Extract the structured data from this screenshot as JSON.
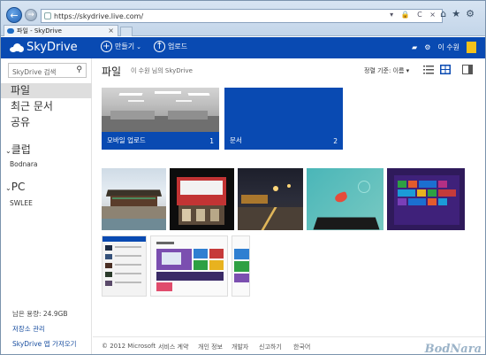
{
  "browser": {
    "url": "https://skydrive.live.com/",
    "tab_title": "파일 - SkyDrive",
    "back_glyph": "←",
    "forward_glyph": "→",
    "addr_tools": "▾ 🔒 C ×",
    "icons": [
      "home-icon",
      "star-icon",
      "gear-icon"
    ],
    "tab_close": "×"
  },
  "header": {
    "brand": "SkyDrive",
    "create_label": "만들기",
    "create_glyph": "+",
    "upload_label": "업로드",
    "upload_glyph": "↑",
    "user_name": "이 수원",
    "tool_icons": [
      "chat-icon",
      "gear-icon"
    ],
    "brand_color": "#094ab2"
  },
  "sidebar": {
    "search_placeholder": "SkyDrive 검색",
    "nav": [
      {
        "label": "파일",
        "selected": true
      },
      {
        "label": "최근 문서",
        "selected": false
      },
      {
        "label": "공유",
        "selected": false
      }
    ],
    "groups": [
      {
        "label": "클럽",
        "item": "Bodnara"
      },
      {
        "label": "PC",
        "item": "SWLEE"
      }
    ],
    "quota": "남은 용량: 24.9GB",
    "manage_link": "저장소 관리",
    "app_link": "SkyDrive 앱 가져오기"
  },
  "main": {
    "title": "파일",
    "crumb": "이 수원 님의 SkyDrive",
    "sort_label": "정렬 기준: 이름 ▾",
    "folders": [
      {
        "name": "모바일 업로드",
        "count": "1"
      },
      {
        "name": "문서",
        "count": "2"
      }
    ]
  },
  "footer": {
    "copyright": "© 2012 Microsoft",
    "links": [
      "서비스 계약",
      "개인 정보",
      "개발자",
      "신고하기",
      "한국어"
    ],
    "watermark": "BodNara"
  }
}
